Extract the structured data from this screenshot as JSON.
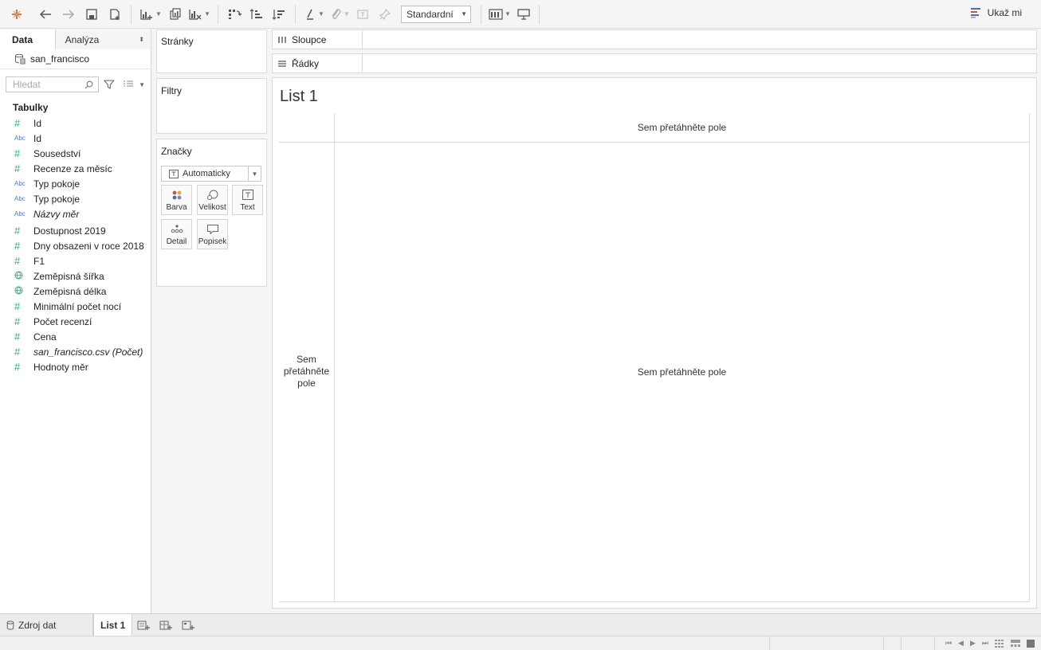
{
  "toolbar": {
    "style_select": "Standardní",
    "show_me_label": "Ukaž mi",
    "accent": "#4a6fa5"
  },
  "left_pane": {
    "tab_data": "Data",
    "tab_analysis": "Analýza",
    "datasource": "san_francisco",
    "search_placeholder": "Hledat",
    "tables_heading": "Tabulky",
    "fields": [
      {
        "type": "#",
        "label": "Id"
      },
      {
        "type": "Abc",
        "label": "Id"
      },
      {
        "type": "#",
        "label": "Sousedství"
      },
      {
        "type": "#",
        "label": "Recenze za měsíc"
      },
      {
        "type": "Abc",
        "label": "Typ pokoje"
      },
      {
        "type": "Abc",
        "label": "Typ pokoje"
      },
      {
        "type": "Abc",
        "label": "Názvy měr"
      },
      {
        "type": "#",
        "label": "Dostupnost 2019"
      },
      {
        "type": "#",
        "label": "Dny obsazeni v roce 2018"
      },
      {
        "type": "#",
        "label": "F1"
      },
      {
        "type": "globe",
        "label": "Zeměpisná šířka"
      },
      {
        "type": "globe",
        "label": "Zeměpisná délka"
      },
      {
        "type": "#",
        "label": "Minimální počet nocí"
      },
      {
        "type": "#",
        "label": "Počet recenzí"
      },
      {
        "type": "#",
        "label": "Cena"
      },
      {
        "type": "#",
        "label": "san_francisco.csv (Počet)"
      },
      {
        "type": "#",
        "label": "Hodnoty měr"
      }
    ]
  },
  "cards": {
    "pages": "Stránky",
    "filters": "Filtry",
    "marks": "Značky",
    "marks_type": "Automaticky",
    "marks_buttons": {
      "color": "Barva",
      "size": "Velikost",
      "text": "Text",
      "detail": "Detail",
      "tooltip": "Popisek"
    }
  },
  "shelves": {
    "columns": "Sloupce",
    "rows": "Řádky"
  },
  "sheet": {
    "title": "List 1",
    "drop_top": "Sem přetáhněte pole",
    "drop_left": "Sem přetáhněte pole",
    "drop_main": "Sem přetáhněte pole"
  },
  "bottom": {
    "data_source": "Zdroj dat",
    "sheet_tab": "List 1"
  }
}
